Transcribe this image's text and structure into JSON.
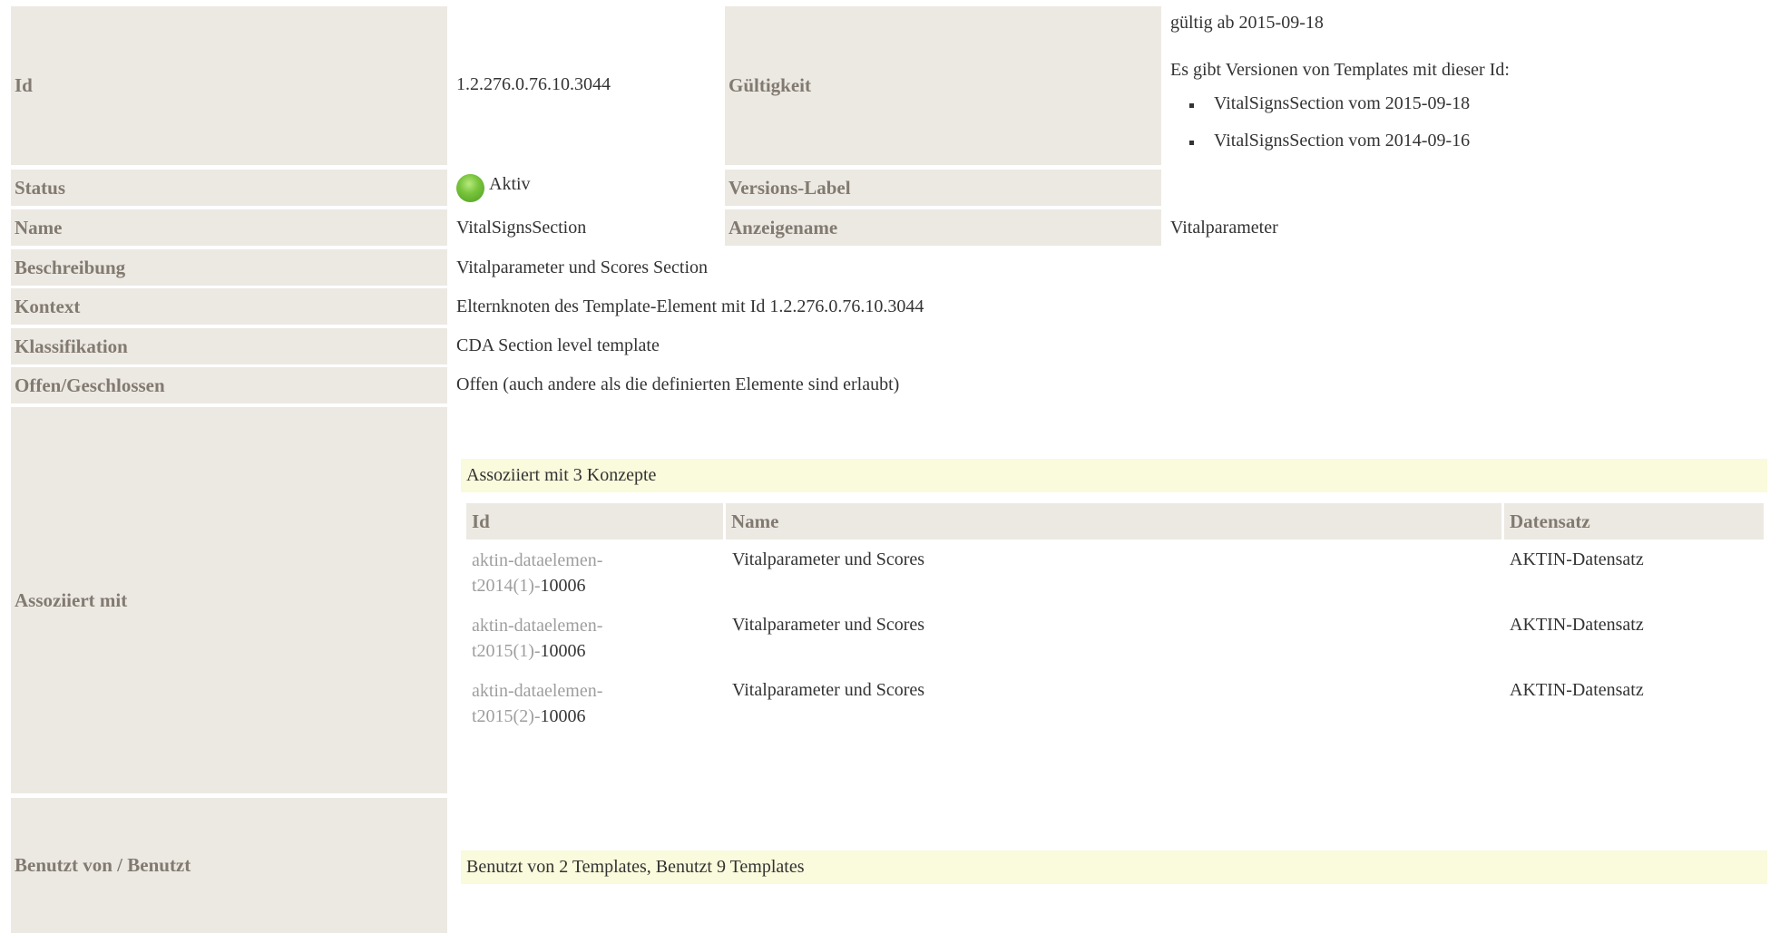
{
  "rows": {
    "id": {
      "label": "Id",
      "value": "1.2.276.0.76.10.3044"
    },
    "validity": {
      "label": "Gültigkeit",
      "valid_from": "gültig ab 2015-09-18",
      "versions_intro": "Es gibt Versionen von Templates mit dieser Id:",
      "versions": [
        "VitalSignsSection vom 2015-09-18",
        "VitalSignsSection vom 2014-09-16"
      ]
    },
    "status": {
      "label": "Status",
      "value": "Aktiv",
      "color": "#6cbb33"
    },
    "version_label": {
      "label": "Versions-Label",
      "value": ""
    },
    "name": {
      "label": "Name",
      "value": "VitalSignsSection"
    },
    "display_name": {
      "label": "Anzeigename",
      "value": "Vitalparameter"
    },
    "description": {
      "label": "Beschreibung",
      "value": "Vitalparameter und Scores Section"
    },
    "context": {
      "label": "Kontext",
      "value": "Elternknoten des Template-Element mit Id 1.2.276.0.76.10.3044"
    },
    "classification": {
      "label": "Klassifikation",
      "value": "CDA Section level template"
    },
    "open_closed": {
      "label": "Offen/Geschlossen",
      "value": "Offen (auch andere als die definierten Elemente sind erlaubt)"
    },
    "associated": {
      "label": "Assoziiert mit",
      "summary": "Assoziiert mit 3 Konzepte",
      "columns": [
        "Id",
        "Name",
        "Datensatz"
      ],
      "concepts": [
        {
          "id_line1": "aktin-dataelemen-",
          "id_line2_prefix": "t2014(1)-",
          "id_suffix": "10006",
          "name": "Vitalparameter und Scores",
          "dataset": "AKTIN-Datensatz"
        },
        {
          "id_line1": "aktin-dataelemen-",
          "id_line2_prefix": "t2015(1)-",
          "id_suffix": "10006",
          "name": "Vitalparameter und Scores",
          "dataset": "AKTIN-Datensatz"
        },
        {
          "id_line1": "aktin-dataelemen-",
          "id_line2_prefix": "t2015(2)-",
          "id_suffix": "10006",
          "name": "Vitalparameter und Scores",
          "dataset": "AKTIN-Datensatz"
        }
      ]
    },
    "used_by": {
      "label": "Benutzt von / Benutzt",
      "summary": "Benutzt von 2 Templates, Benutzt 9 Templates"
    }
  },
  "colors": {
    "header_bg": "#ece9e3",
    "header_text": "#827a71",
    "highlight_bg": "#fafadc"
  }
}
